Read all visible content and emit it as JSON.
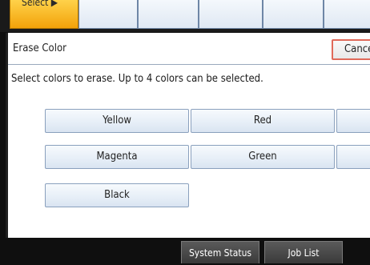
{
  "top_strip": {
    "select_label": "Select"
  },
  "dialog": {
    "title": "Erase Color",
    "cancel_label": "Cancel",
    "instruction": "Select colors to erase. Up to 4 colors can be selected.",
    "colors": [
      "Yellow",
      "Red",
      "Magenta",
      "Green",
      "Black"
    ]
  },
  "status_bar": {
    "system_status_label": "System Status",
    "job_list_label": "Job List"
  }
}
